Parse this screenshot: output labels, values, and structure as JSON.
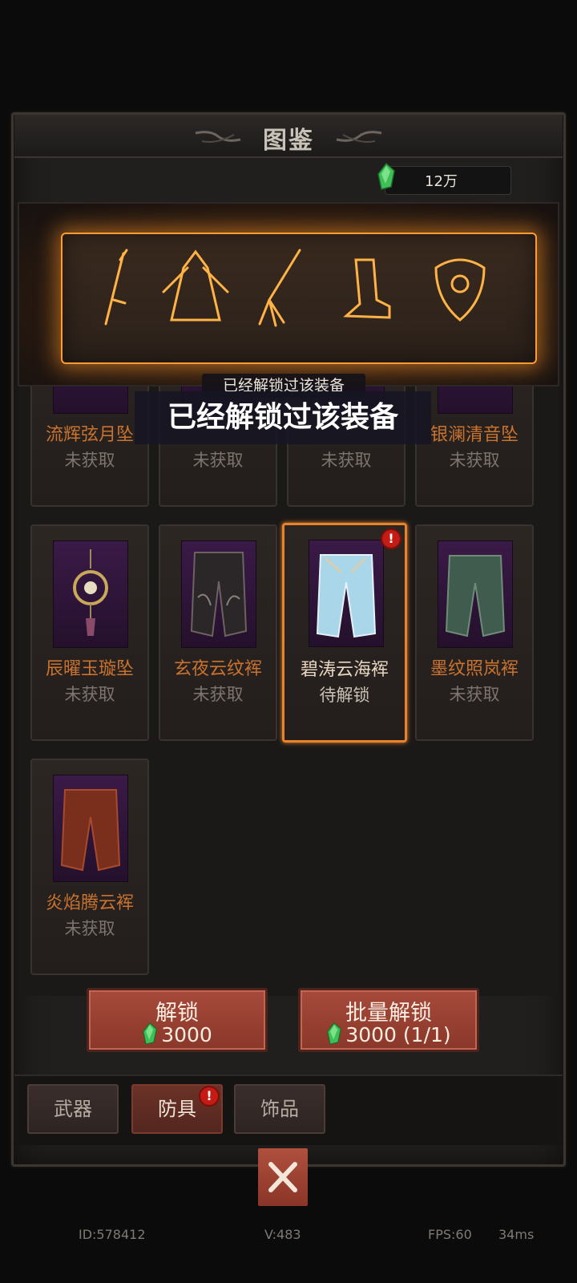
{
  "header": {
    "title": "图鉴"
  },
  "currency": {
    "icon": "green-gem-icon",
    "value": "12万"
  },
  "banner": {
    "items": [
      "sword-icon",
      "robe-icon",
      "brush-icon",
      "boot-icon",
      "pendant-icon"
    ]
  },
  "tooltip": {
    "small": "已经解锁过该装备",
    "large": "已经解锁过该装备"
  },
  "grid": {
    "row1": [
      {
        "name": "流辉弦月坠",
        "status": "未获取"
      },
      {
        "name": "",
        "status": "未获取"
      },
      {
        "name": "",
        "status": "未获取"
      },
      {
        "name": "银澜清音坠",
        "status": "未获取"
      }
    ],
    "row2": [
      {
        "name": "辰曜玉璇坠",
        "status": "未获取"
      },
      {
        "name": "玄夜云纹裈",
        "status": "未获取"
      },
      {
        "name": "碧涛云海裈",
        "status": "待解锁"
      },
      {
        "name": "墨纹照岚裈",
        "status": "未获取"
      }
    ],
    "row3": [
      {
        "name": "炎焰腾云裈",
        "status": "未获取"
      }
    ]
  },
  "buttons": {
    "unlock": {
      "label": "解锁",
      "cost": "3000"
    },
    "batch_unlock": {
      "label": "批量解锁",
      "cost": "3000 (1/1)"
    }
  },
  "tabs": [
    {
      "label": "武器"
    },
    {
      "label": "防具"
    },
    {
      "label": "饰品"
    }
  ],
  "footer": {
    "id": "ID:578412",
    "version": "V:483",
    "fps": "FPS:60",
    "latency": "34ms"
  },
  "colors": {
    "accent": "#e8832b",
    "button": "#9a4232",
    "item_name": "#c9732f"
  }
}
